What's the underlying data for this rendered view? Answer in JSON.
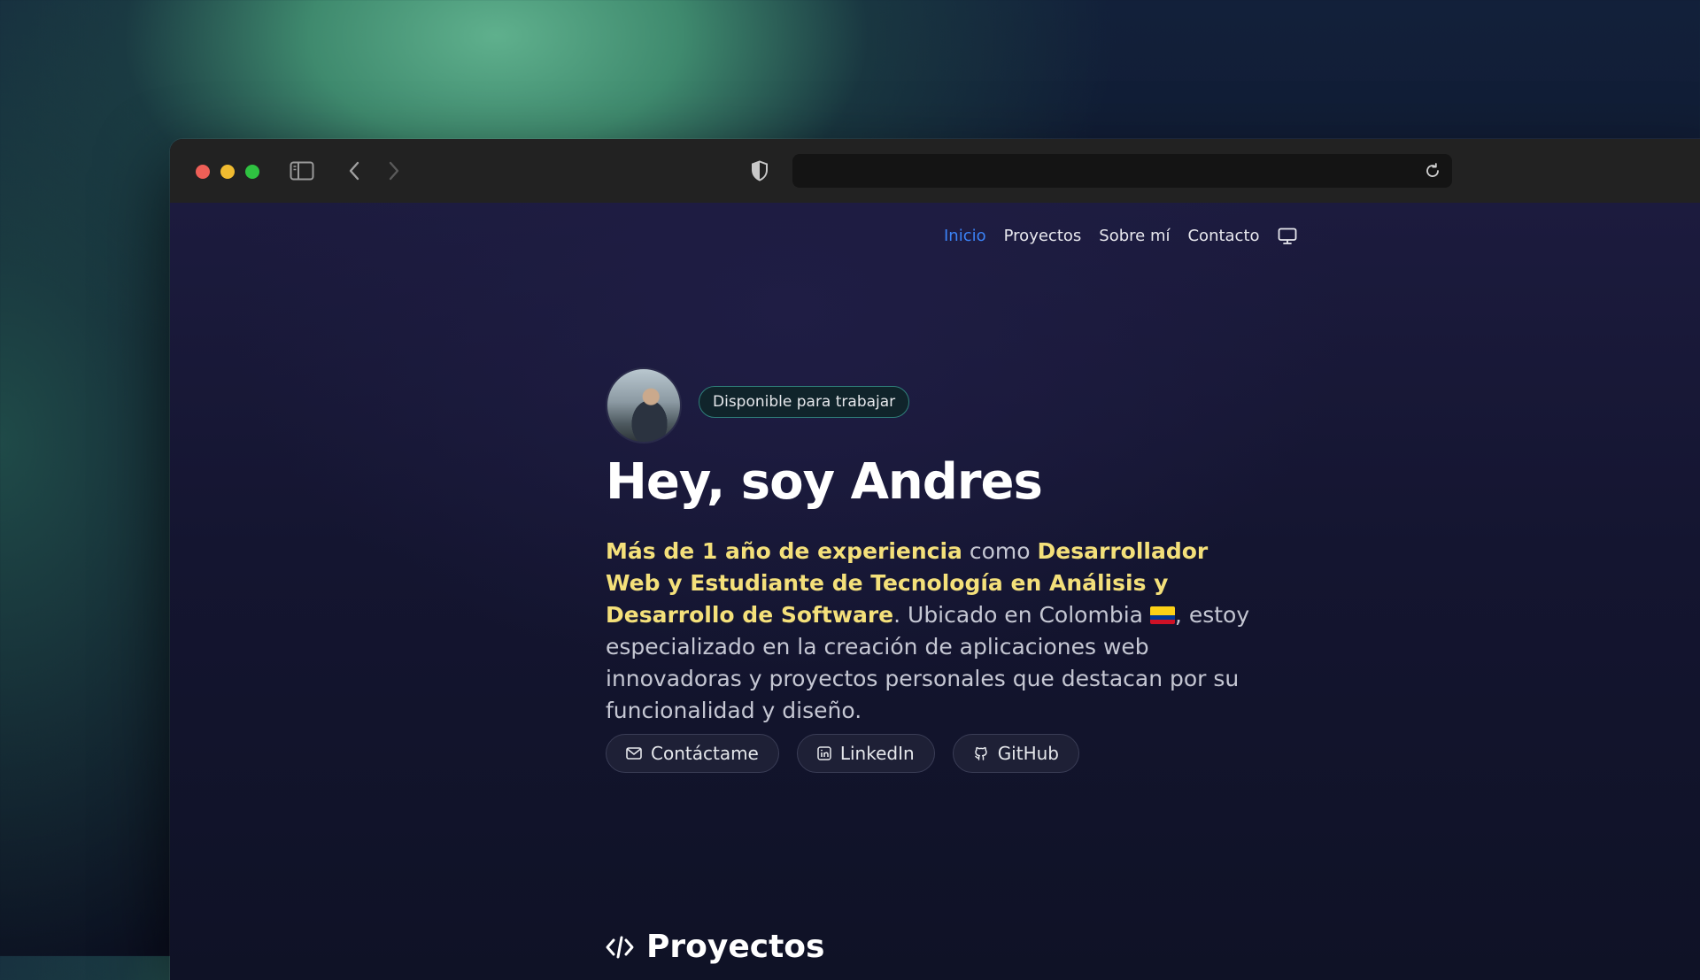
{
  "nav": {
    "items": [
      "Inicio",
      "Proyectos",
      "Sobre mí",
      "Contacto"
    ],
    "active": "Inicio"
  },
  "icons": {
    "sidebar": "sidebar-toggle-icon",
    "back": "chevron-left-icon",
    "forward": "chevron-right-icon",
    "shield": "shield-icon",
    "reload": "reload-icon",
    "theme": "monitor-icon",
    "mail": "mail-icon",
    "linkedin": "linkedin-icon",
    "github": "github-icon",
    "code": "code-icon"
  },
  "hero": {
    "badge": "Disponible para trabajar",
    "title": "Hey, soy Andres",
    "highlight1": "Más de 1 año de experiencia",
    "text1": " como ",
    "highlight2": "Desarrollador Web y Estudiante de Tecnología en Análisis y Desarrollo de Software",
    "text2": ". Ubicado en Colombia ",
    "text3": ", estoy especializado en la creación de aplicaciones web innovadoras y proyectos personales que destacan por su funcionalidad y diseño.",
    "buttons": [
      "Contáctame",
      "LinkedIn",
      "GitHub"
    ]
  },
  "sections": {
    "projects_title": "Proyectos"
  },
  "colors": {
    "nav_active": "#3b82f6",
    "highlight": "#f4e07a",
    "badge_border": "#2f7f7a"
  }
}
